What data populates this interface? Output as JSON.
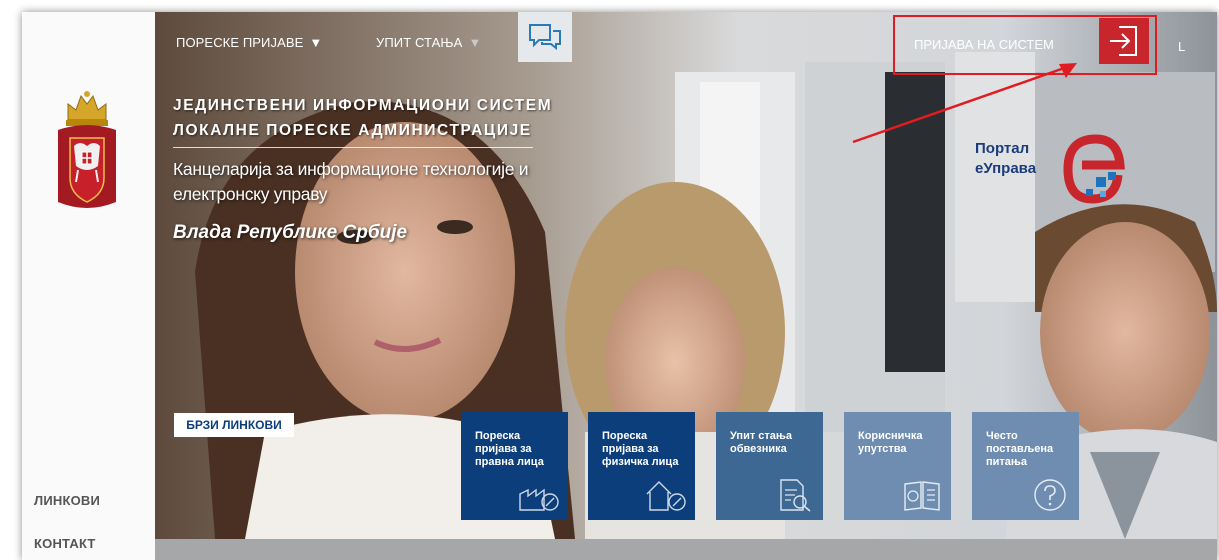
{
  "sidebar": {
    "links": [
      "ЛИНКОВИ",
      "КОНТАКТ"
    ]
  },
  "nav": {
    "items": [
      {
        "label": "ПОРЕСКЕ ПРИЈАВЕ",
        "caret": "▼"
      },
      {
        "label": "УПИТ СТАЊА",
        "caret": "▼"
      }
    ],
    "chat_icon": "chat-bubbles-icon"
  },
  "header": {
    "title_lines": [
      "ЈЕДИНСТВЕНИ ИНФОРМАЦИОНИ СИСТЕМ",
      "ЛОКАЛНЕ ПОРЕСКЕ АДМИНИСТРАЦИЈЕ"
    ],
    "subtitle_lines": [
      "Канцеларија за информационе технологије и",
      "електронску управу"
    ],
    "government": "Влада Републике Србије"
  },
  "login": {
    "label": "ПРИЈАВА НА СИСТЕМ",
    "icon": "login-icon",
    "lang": "L"
  },
  "portal": {
    "lines": [
      "Портал",
      "еУправа"
    ]
  },
  "quick_links": {
    "label": "БРЗИ ЛИНКОВИ",
    "tiles": [
      {
        "label": "Пореска пријава за правна лица",
        "icon": "factory-percent-icon",
        "color": "#0b3e7a"
      },
      {
        "label": "Пореска пријава за физичка лица",
        "icon": "house-percent-icon",
        "color": "#0b3e7a"
      },
      {
        "label": "Упит стања обвезника",
        "icon": "document-search-icon",
        "color": "#3e6894"
      },
      {
        "label": "Корисничка упутства",
        "icon": "info-book-icon",
        "color": "#6f8db1"
      },
      {
        "label": "Често постављена питања",
        "icon": "question-icon",
        "color": "#6f8db1"
      }
    ]
  },
  "colors": {
    "accent_red": "#e01b22",
    "login_button": "#c8252c",
    "tile_dark": "#0b3e7a",
    "portal_blue": "#1b3c7a"
  }
}
